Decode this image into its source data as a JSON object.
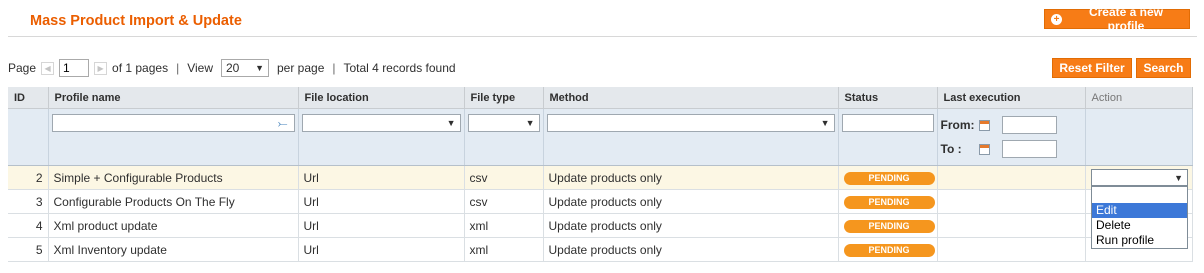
{
  "header": {
    "title": "Mass Product Import & Update",
    "create_button": "Create a new profile"
  },
  "pager": {
    "page_label": "Page",
    "page_value": "1",
    "of_pages": "of 1 pages",
    "view_label": "View",
    "per_page_value": "20",
    "per_page_label": "per page",
    "total": "Total 4 records found"
  },
  "filters": {
    "reset_button": "Reset Filter",
    "search_button": "Search",
    "from_label": "From:",
    "to_label": "To :"
  },
  "columns": [
    "ID",
    "Profile name",
    "File location",
    "File type",
    "Method",
    "Status",
    "Last execution",
    "Action"
  ],
  "rows": [
    {
      "id": "2",
      "name": "Simple + Configurable Products",
      "location": "Url",
      "type": "csv",
      "method": "Update products only",
      "status": "PENDING"
    },
    {
      "id": "3",
      "name": "Configurable Products On The Fly",
      "location": "Url",
      "type": "csv",
      "method": "Update products only",
      "status": "PENDING"
    },
    {
      "id": "4",
      "name": "Xml product update",
      "location": "Url",
      "type": "xml",
      "method": "Update products only",
      "status": "PENDING"
    },
    {
      "id": "5",
      "name": "Xml Inventory update",
      "location": "Url",
      "type": "xml",
      "method": "Update products only",
      "status": "PENDING"
    }
  ],
  "action_dropdown": {
    "options": [
      "Edit",
      "Delete",
      "Run profile"
    ],
    "highlighted": "Edit"
  },
  "colors": {
    "accent": "#eb5e00",
    "button": "#f77c16",
    "pending": "#f5961e",
    "selection": "#3c78d8"
  },
  "icons": {
    "create": "plus-circle-icon",
    "filter_wand": "magic-wand-icon",
    "calendar": "calendar-icon",
    "dropdown": "caret-down-icon"
  }
}
